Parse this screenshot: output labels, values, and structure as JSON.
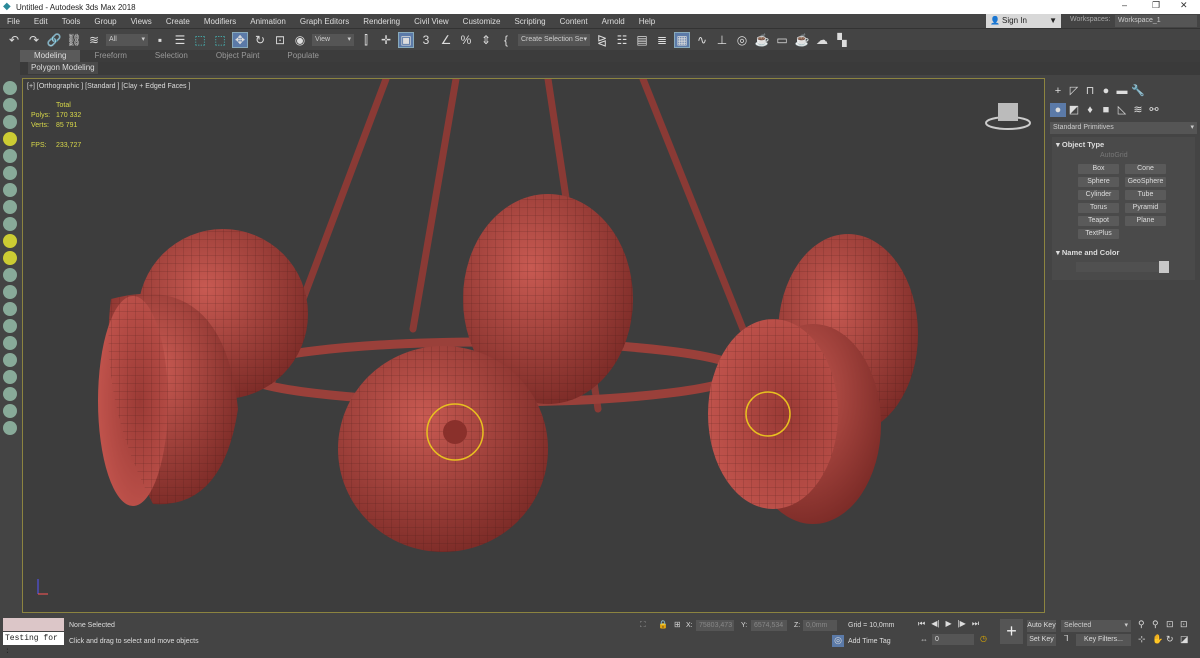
{
  "window": {
    "title": "Untitled - Autodesk 3ds Max 2018",
    "min": "–",
    "max": "❐",
    "close": "✕"
  },
  "menu": [
    "File",
    "Edit",
    "Tools",
    "Group",
    "Views",
    "Create",
    "Modifiers",
    "Animation",
    "Graph Editors",
    "Rendering",
    "Civil View",
    "Customize",
    "Scripting",
    "Content",
    "Arnold",
    "Help"
  ],
  "account": {
    "sign_in": "Sign In",
    "workspaces_label": "Workspaces:",
    "workspace": "Workspace_1"
  },
  "toolbar": {
    "selection_filter": "All",
    "reference_coord": "View",
    "named_selection": "Create Selection Se",
    "snap_label": "3"
  },
  "ribbon": {
    "tabs": [
      "Modeling",
      "Freeform",
      "Selection",
      "Object Paint",
      "Populate"
    ],
    "active": "Modeling",
    "panel": "Polygon Modeling"
  },
  "viewport": {
    "label": "[+] [Orthographic ] [Standard ] [Clay + Edged Faces ]",
    "stats": {
      "header": "Total",
      "polys_label": "Polys:",
      "polys": "170 332",
      "verts_label": "Verts:",
      "verts": "85 791",
      "fps_label": "FPS:",
      "fps": "233,727"
    }
  },
  "command_panel": {
    "category": "Standard Primitives",
    "object_type": "Object Type",
    "autogrid": "AutoGrid",
    "buttons": [
      "Box",
      "Cone",
      "Sphere",
      "GeoSphere",
      "Cylinder",
      "Tube",
      "Torus",
      "Pyramid",
      "Teapot",
      "Plane",
      "TextPlus"
    ],
    "name_and_color": "Name and Color"
  },
  "status": {
    "script_input": "Testing for :",
    "selection": "None Selected",
    "prompt": "Click and drag to select and move objects",
    "x_label": "X:",
    "x": "75803,473",
    "y_label": "Y:",
    "y": "6574,534",
    "z_label": "Z:",
    "z": "0,0mm",
    "grid": "Grid = 10,0mm",
    "add_time_tag": "Add Time Tag",
    "frame": "0",
    "auto_key": "Auto Key",
    "set_key": "Set Key",
    "key_mode": "Selected",
    "key_filters": "Key Filters..."
  },
  "colors": {
    "model": "#b24a44",
    "viewport_border": "#8c8440",
    "stats": "#d8d84a",
    "accent": "#5b7aa8"
  }
}
